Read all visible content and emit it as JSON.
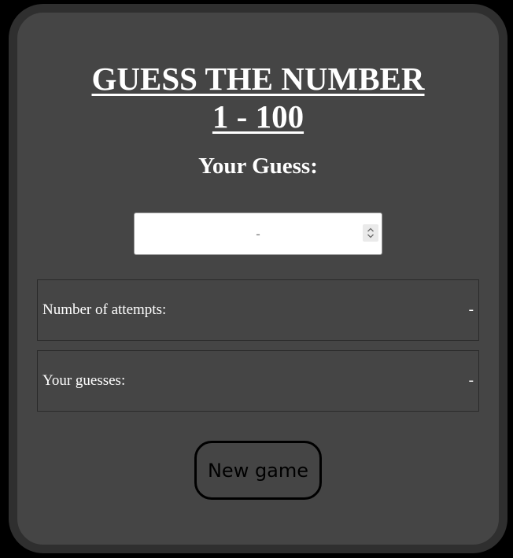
{
  "title": {
    "line1": "GUESS THE NUMBER",
    "line2": "1 - 100"
  },
  "guess": {
    "label": "Your Guess:",
    "placeholder": "-"
  },
  "stats": {
    "attempts_label": "Number of attempts:",
    "attempts_value": "-",
    "guesses_label": "Your guesses:",
    "guesses_value": "-"
  },
  "actions": {
    "new_game_label": "New game"
  },
  "colors": {
    "page_background": "#000000",
    "card_background": "#454545",
    "card_border": "#2f2f2f",
    "text": "#ffffff"
  },
  "icons": {
    "spinner": "chevron-up-down-icon"
  }
}
